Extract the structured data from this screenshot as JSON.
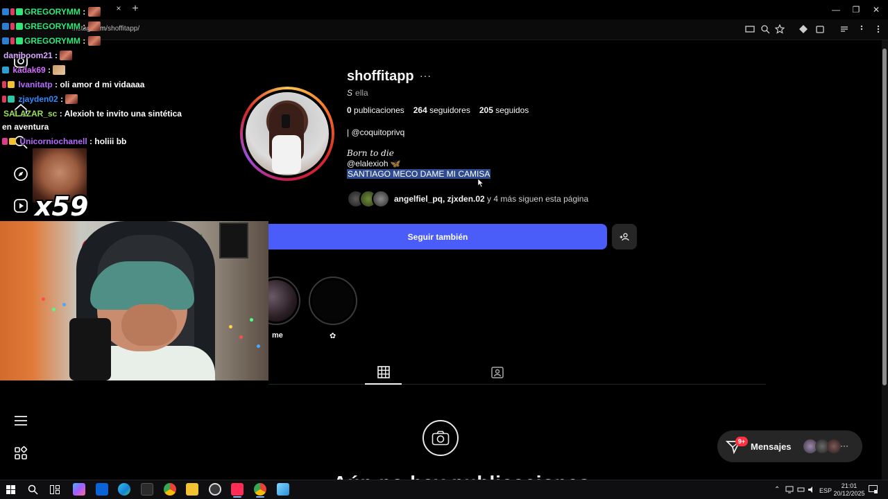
{
  "browser": {
    "url_prefix": "instag",
    "url_host": ".com",
    "url_path": "/shoffitapp/",
    "tab_close": "×",
    "tab_new": "+",
    "win_min": "—",
    "win_max": "❐",
    "win_close": "✕"
  },
  "profile": {
    "username": "shoffitapp",
    "more": "···",
    "pronoun_prefix": "S",
    "pronoun": "ella",
    "posts_count": "0",
    "posts_label": "publicaciones",
    "followers_count": "264",
    "followers_label": "seguidores",
    "following_count": "205",
    "following_label": "seguidos",
    "bio_1": "| @coquitoprivq",
    "bio_2": "Born to die",
    "bio_3": "@elalexioh ",
    "bio_3_emoji": "🦋",
    "bio_4": "SANTIAGO MECO DAME MI CAMISA",
    "followed_by_names": "angelfiel_pq, zjxden.02",
    "followed_by_rest": " y 4 más siguen esta página",
    "follow_button": "Seguir también",
    "highlight_1_label": "me",
    "highlight_2_label": "✿"
  },
  "messages": {
    "label": "Mensajes",
    "badge": "9+",
    "more": "···"
  },
  "empty_state": {
    "title": "Aún no hay publicaciones"
  },
  "chat": [
    {
      "user": "GREGORYMM",
      "color": "#2ee87a",
      "text": ":"
    },
    {
      "user": "GREGORYMM",
      "color": "#2ee87a",
      "text": ":"
    },
    {
      "user": "GREGORYMM",
      "color": "#2ee87a",
      "text": ":"
    },
    {
      "user": "danjboom21",
      "color": "#d9a6ff",
      "text": ":"
    },
    {
      "user": "kadak69",
      "color": "#d36bff",
      "text": ":"
    },
    {
      "user": "lvanitatp",
      "color": "#b46bff",
      "text": ": oli amor d mi vidaaaa"
    },
    {
      "user": "zjayden02",
      "color": "#2f8bff",
      "text": ":"
    },
    {
      "user": "SALAZAR_sc",
      "color": "#9be05a",
      "text": ": Alexioh te invito una sintética"
    },
    {
      "user": "",
      "color": "#ffffff",
      "text": "en aventura"
    },
    {
      "user": "Unicorniochanell",
      "color": "#b46bff",
      "text": ": holiii bb"
    }
  ],
  "emote_overlay": {
    "multiplier": "x59"
  },
  "taskbar": {
    "lang": "ESP",
    "time": "21:01",
    "date": "20/12/2025"
  },
  "colors": {
    "follow_button": "#4a5df9",
    "selection": "#2e4b8f",
    "badge": "#ff3040"
  }
}
